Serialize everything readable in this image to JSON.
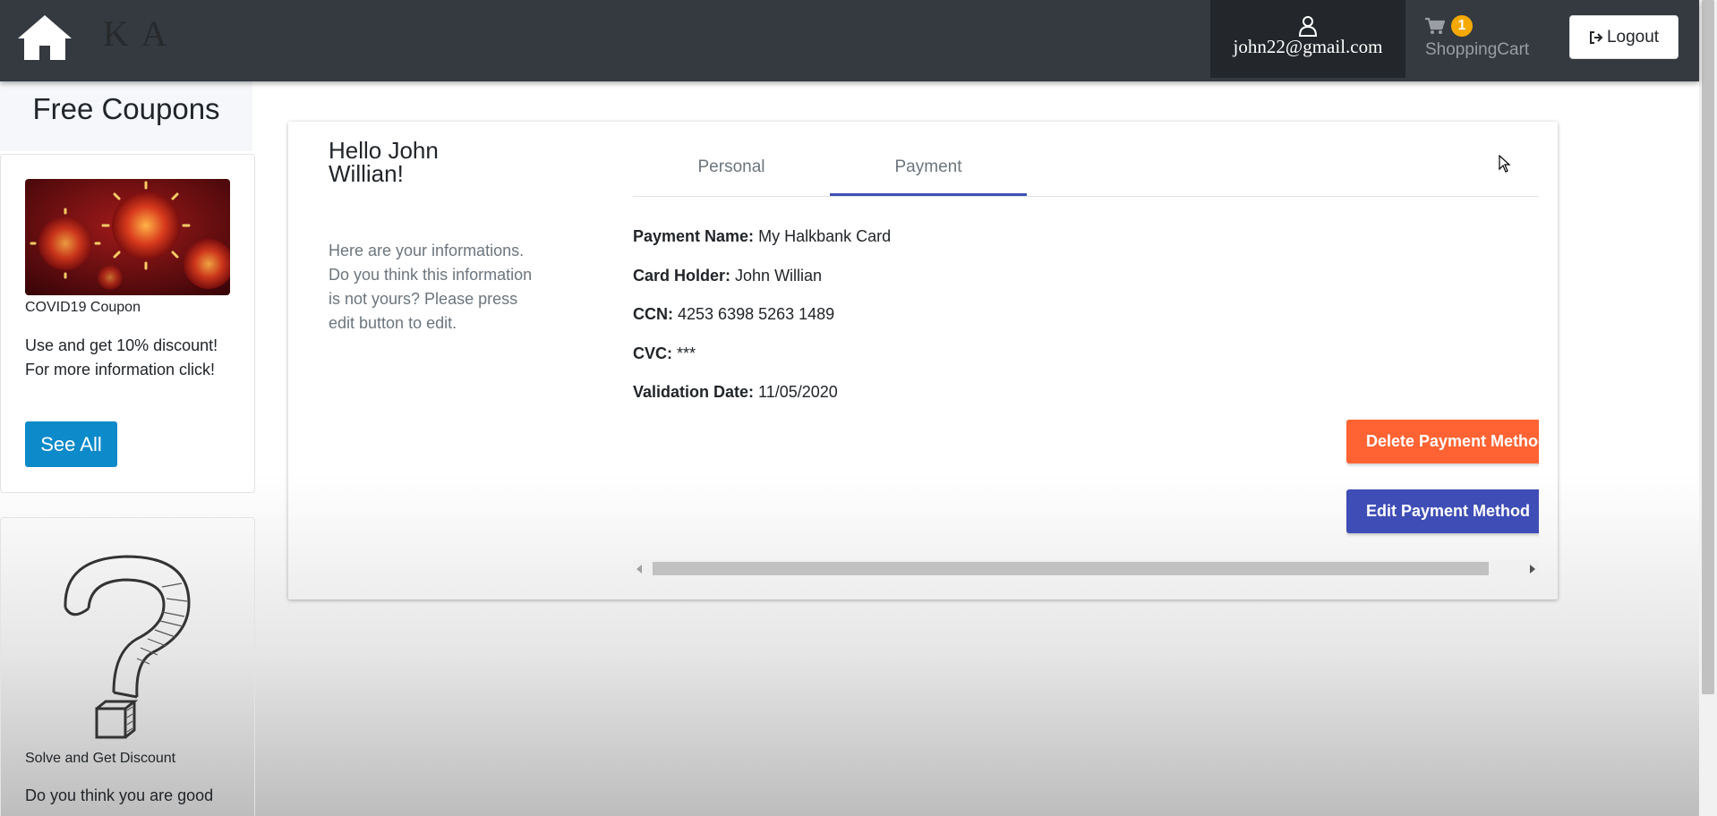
{
  "navbar": {
    "logo_text": "K A",
    "user_email": "john22@gmail.com",
    "cart_count": "1",
    "cart_label": "ShoppingCart",
    "logout_label": "Logout"
  },
  "sidebar": {
    "title": "Free Coupons",
    "coupon": {
      "caption": "COVID19 Coupon",
      "text": "Use and get 10% discount! For more information click!",
      "button_label": "See All"
    },
    "puzzle": {
      "caption": "Solve and Get Discount",
      "text": "Do you think you are good"
    }
  },
  "profile": {
    "greeting": "Hello John Willian!",
    "info_text": "Here are your informations. Do you think this information is not yours? Please press edit button to edit.",
    "tabs": [
      {
        "label": "Personal",
        "active": false
      },
      {
        "label": "Payment",
        "active": true
      }
    ],
    "payment": {
      "name_label": "Payment Name:",
      "name_value": "My Halkbank Card",
      "holder_label": "Card Holder:",
      "holder_value": "John Willian",
      "ccn_label": "CCN:",
      "ccn_value": "4253 6398 5263 1489",
      "cvc_label": "CVC:",
      "cvc_value": "***",
      "date_label": "Validation Date:",
      "date_value": "11/05/2020"
    },
    "delete_label": "Delete Payment Method",
    "edit_label": "Edit Payment Method"
  },
  "colors": {
    "navbar": "#343a40",
    "accent": "#3f51b5",
    "delete": "#ff6333",
    "see_all": "#0d8ac9",
    "badge": "#f5a900"
  }
}
